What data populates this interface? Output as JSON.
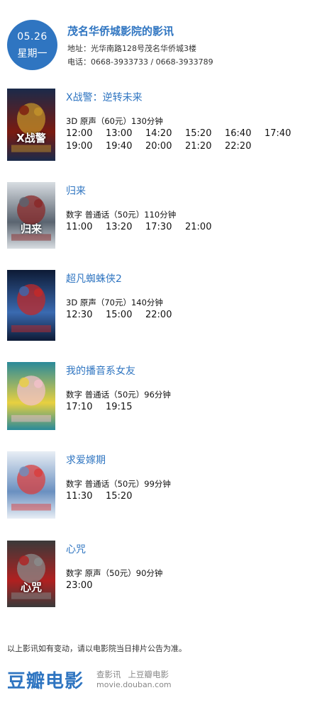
{
  "header": {
    "date": "05.26",
    "weekday": "星期一",
    "cinema_name": "茂名华侨城影院的影讯",
    "address": "地址：光华南路128号茂名华侨城3楼",
    "phone": "电话：0668-3933733 / 0668-3933789"
  },
  "movies": [
    {
      "title": "X战警：逆转未来",
      "info": "3D  原声（60元）130分钟",
      "times": [
        "12:00",
        "13:00",
        "14:20",
        "15:20",
        "16:40",
        "17:40",
        "19:00",
        "19:40",
        "20:00",
        "21:20",
        "22:20"
      ],
      "poster_text": "X战警",
      "poster_colors": [
        "#1a2a4a",
        "#c0902a",
        "#7a1a10"
      ]
    },
    {
      "title": "归来",
      "info": "数字  普通话（50元）110分钟",
      "times": [
        "11:00",
        "13:20",
        "17:30",
        "21:00"
      ],
      "poster_text": "归来",
      "poster_colors": [
        "#d8dde2",
        "#8a2a2a",
        "#5a6470"
      ]
    },
    {
      "title": "超凡蜘蛛侠2",
      "info": "3D  原声（70元）140分钟",
      "times": [
        "12:30",
        "15:00",
        "22:00"
      ],
      "poster_text": "",
      "poster_colors": [
        "#0d1a35",
        "#c02a2a",
        "#3a6ab0"
      ]
    },
    {
      "title": "我的播音系女友",
      "info": "数字  普通话（50元）96分钟",
      "times": [
        "17:10",
        "19:15"
      ],
      "poster_text": "",
      "poster_colors": [
        "#2a8a9a",
        "#f0c0c8",
        "#e8d040"
      ]
    },
    {
      "title": "求爱嫁期",
      "info": "数字  普通话（50元）99分钟",
      "times": [
        "11:30",
        "15:20"
      ],
      "poster_text": "",
      "poster_colors": [
        "#e8eef5",
        "#d84040",
        "#6a90c0"
      ]
    },
    {
      "title": "心咒",
      "info": "数字  原声（50元）90分钟",
      "times": [
        "23:00"
      ],
      "poster_text": "心咒",
      "poster_colors": [
        "#3a3a3a",
        "#8a8a8a",
        "#b02020"
      ]
    }
  ],
  "footer": {
    "note": "以上影讯如有变动，请以电影院当日排片公告为准。",
    "logo": "豆瓣电影",
    "link_1": "查影讯",
    "link_2": "上豆瓣电影",
    "url": "movie.douban.com"
  },
  "colors": {
    "accent": "#2f75c1"
  }
}
